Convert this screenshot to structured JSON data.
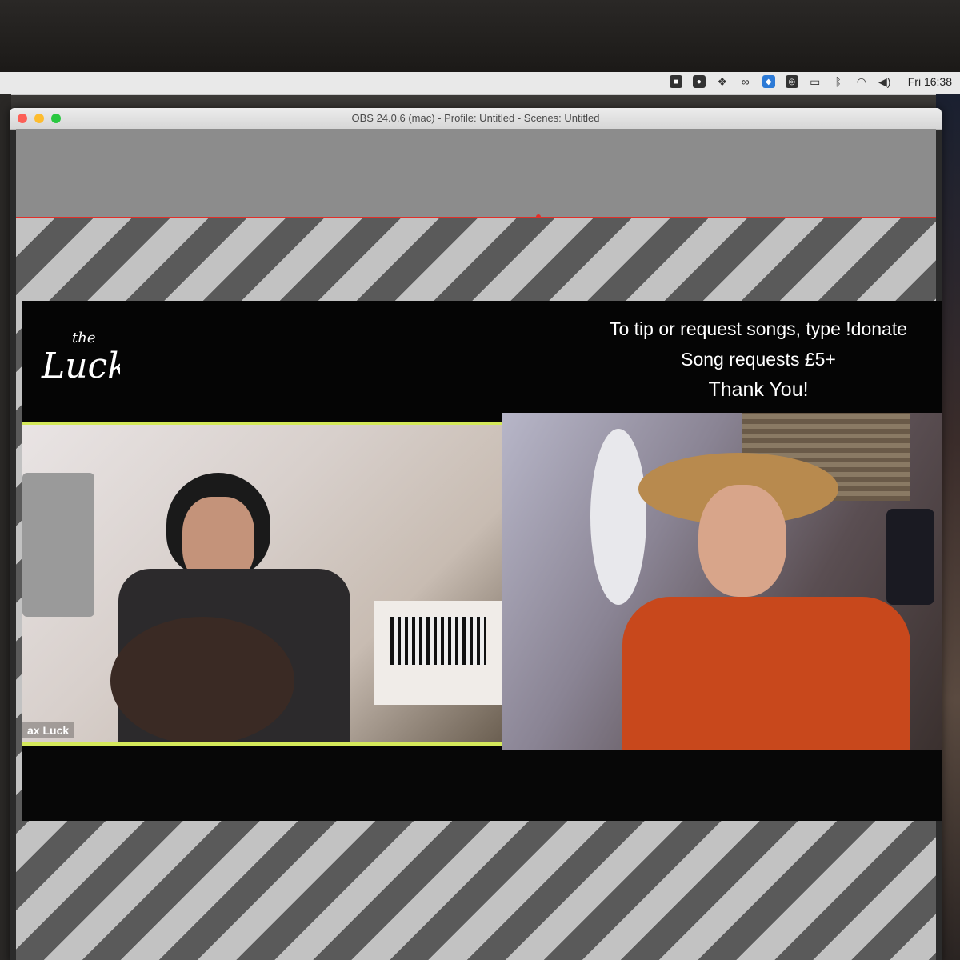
{
  "menubar": {
    "icons": [
      "zoom-icon",
      "obs-icon",
      "dropbox-icon",
      "creative-cloud-icon",
      "bluetooth-audio-icon",
      "radio-icon",
      "airplay-icon",
      "bluetooth-icon",
      "wifi-icon",
      "volume-icon"
    ],
    "clock": "Fri 16:38"
  },
  "window": {
    "title": "OBS 24.0.6 (mac) - Profile: Untitled - Scenes: Untitled"
  },
  "scene": {
    "logo_text": "the Luck",
    "message": {
      "line1": "To tip or request songs, type !donate",
      "line2": "Song requests £5+",
      "line3": "Thank You!"
    },
    "left_cam_name": "ax Luck",
    "border_color": "#d4e85a"
  }
}
